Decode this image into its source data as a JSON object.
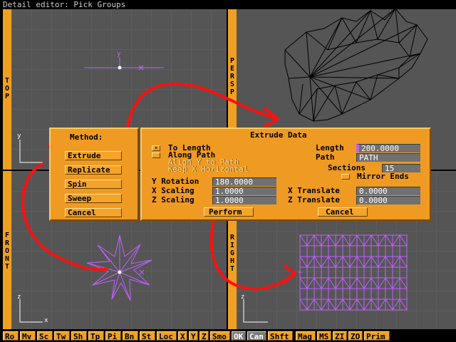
{
  "window": {
    "title": "Detail editor: Pick Groups"
  },
  "viewports": {
    "top": {
      "label": "TOP",
      "axis_y": "y",
      "axis_x": "x"
    },
    "persp": {
      "label": "PERSP"
    },
    "front": {
      "label": "FRONT",
      "axis_y": "z",
      "axis_x": "x"
    },
    "right": {
      "label": "RIGHT",
      "axis_y": "z"
    }
  },
  "method_panel": {
    "title": "Method:",
    "buttons": [
      "Extrude",
      "Replicate",
      "Spin",
      "Sweep",
      "Cancel"
    ]
  },
  "extrude_panel": {
    "title": "Extrude Data",
    "options": {
      "to_length": "To Length",
      "along_path": "Along Path",
      "align_y": "Align Y to Path",
      "keep_x": "Keep X Horizontal",
      "mirror_ends": "Mirror Ends"
    },
    "length_label": "Length",
    "length_value": "200.0000",
    "path_label": "Path",
    "path_value": "PATH",
    "sections_label": "Sections",
    "sections_value": "15",
    "y_rotation_label": "Y Rotation",
    "y_rotation_value": "180.0000",
    "x_scaling_label": "X Scaling",
    "x_scaling_value": "1.0000",
    "z_scaling_label": "Z Scaling",
    "z_scaling_value": "1.0000",
    "x_translate_label": "X Translate",
    "x_translate_value": "0.0000",
    "z_translate_label": "Z Translate",
    "z_translate_value": "0.0000",
    "perform_label": "Perform",
    "cancel_label": "Cancel"
  },
  "toolbar": {
    "items": [
      "Ro",
      "Mv",
      "Sc",
      "Tw",
      "Sh",
      "Tp",
      "Pi",
      "Bn",
      "St",
      "Loc",
      "X",
      "Y",
      "Z",
      "Smo",
      "OK",
      "Can",
      "Shft",
      "Mag",
      "MS",
      "ZI",
      "ZO",
      "Prim"
    ]
  },
  "colors": {
    "accent": "#f0a020",
    "geometry_pink": "#c060ff",
    "arrow": "#ff1010"
  }
}
